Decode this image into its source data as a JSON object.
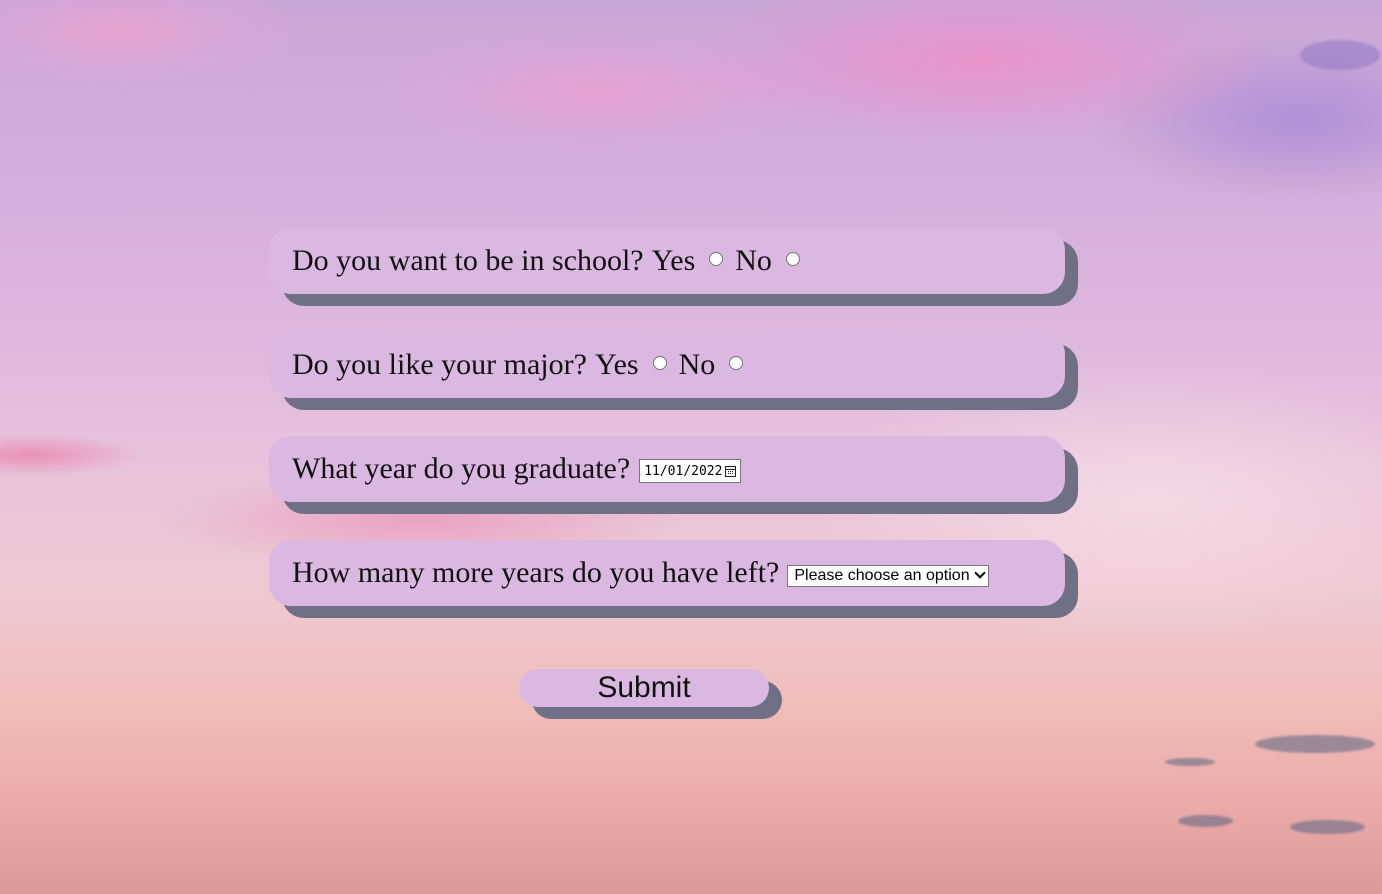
{
  "questions": {
    "school": {
      "label": "Do you want to be in school?",
      "yes_label": "Yes",
      "no_label": "No"
    },
    "major": {
      "label": "Do you like your major?",
      "yes_label": "Yes",
      "no_label": "No"
    },
    "graduate": {
      "label": "What year do you graduate?",
      "date_value": "11/01/2022"
    },
    "years_left": {
      "label": "How many more years do you have left?",
      "selected_option": "Please choose an option"
    }
  },
  "submit_label": "Submit",
  "colors": {
    "panel": "#dbb8e1",
    "shadow": "#6f6f86"
  }
}
